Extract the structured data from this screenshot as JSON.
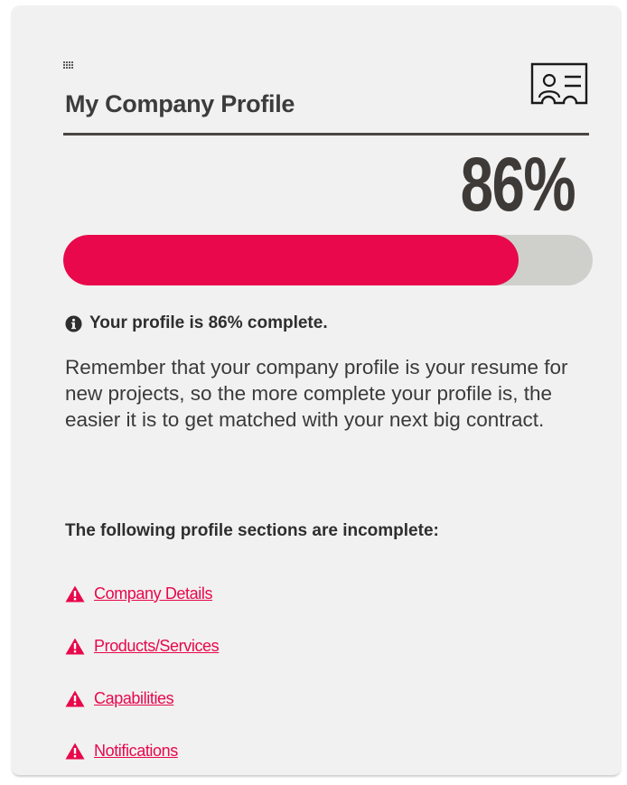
{
  "widget": {
    "title": "My Company Profile",
    "percent_text": "86%",
    "progress_fraction": 0.86,
    "status_text": "Your profile is 86% complete.",
    "description": "Remember that your company profile is your resume for new projects, so the more complete your profile is, the easier it is to get matched with your next big contract.",
    "incomplete_heading": "The following profile sections are incomplete:",
    "incomplete_sections": [
      {
        "label": "Company Details",
        "icon": "warning-icon"
      },
      {
        "label": "Products/Services",
        "icon": "warning-icon"
      },
      {
        "label": "Capabilities",
        "icon": "warning-icon"
      },
      {
        "label": "Notifications",
        "icon": "warning-icon"
      }
    ]
  },
  "icons": {
    "drag": "grip-icon",
    "header": "profile-card-icon",
    "status": "info-icon"
  },
  "colors": {
    "accent": "#e8084b",
    "track": "#cfd0cc",
    "card_background": "#f1f1f1",
    "text_dark": "#3c3c3c"
  }
}
